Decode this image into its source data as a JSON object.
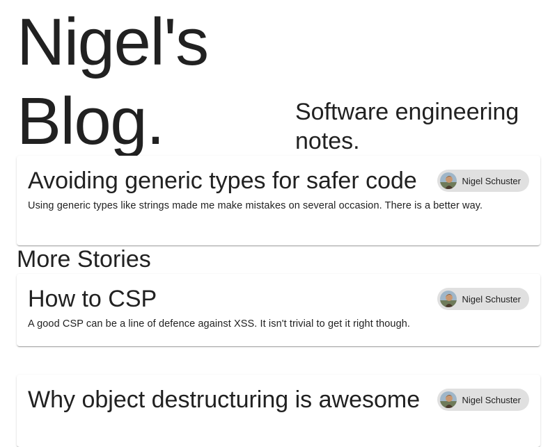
{
  "site": {
    "title": "Nigel's Blog.",
    "tagline": "Software engineering notes."
  },
  "featured": {
    "title": "Avoiding generic types for safer code",
    "description": "Using generic types like strings made me make mistakes on several occasion. There is a better way.",
    "author": "Nigel Schuster"
  },
  "more_stories": {
    "heading": "More Stories",
    "items": [
      {
        "title": "How to CSP",
        "description": "A good CSP can be a line of defence against XSS. It isn't trivial to get it right though.",
        "author": "Nigel Schuster"
      },
      {
        "title": "Why object destructuring is awesome",
        "description": "",
        "author": "Nigel Schuster"
      }
    ]
  },
  "colors": {
    "chip_background": "#e0e0e0",
    "text": "#212121"
  },
  "icons": {
    "author_avatar": "author-avatar-icon"
  }
}
